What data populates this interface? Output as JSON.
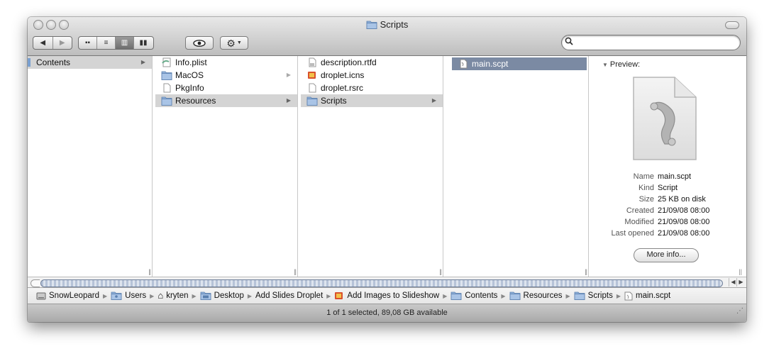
{
  "window": {
    "title": "Scripts"
  },
  "toolbar": {
    "view_buttons": [
      "icon-view-icon",
      "list-view-icon",
      "column-view-icon",
      "coverflow-view-icon"
    ],
    "active_view": "column"
  },
  "columns": [
    {
      "items": [
        {
          "label": "Contents",
          "icon": "folder-icon",
          "selected": true,
          "arrow": true
        }
      ]
    },
    {
      "items": [
        {
          "label": "Info.plist",
          "icon": "plist-file-icon"
        },
        {
          "label": "MacOS",
          "icon": "folder-icon",
          "arrow": true
        },
        {
          "label": "PkgInfo",
          "icon": "document-icon"
        },
        {
          "label": "Resources",
          "icon": "folder-icon",
          "selected": true,
          "arrow": true
        }
      ]
    },
    {
      "items": [
        {
          "label": "description.rtfd",
          "icon": "rtfd-file-icon"
        },
        {
          "label": "droplet.icns",
          "icon": "icns-file-icon"
        },
        {
          "label": "droplet.rsrc",
          "icon": "document-icon"
        },
        {
          "label": "Scripts",
          "icon": "folder-icon",
          "selected": true,
          "arrow": true
        }
      ]
    },
    {
      "items": [
        {
          "label": "main.scpt",
          "icon": "script-file-icon",
          "selected": true
        }
      ]
    }
  ],
  "preview": {
    "label": "Preview:",
    "fields": [
      {
        "key": "Name",
        "value": "main.scpt"
      },
      {
        "key": "Kind",
        "value": "Script"
      },
      {
        "key": "Size",
        "value": "25 KB on disk"
      },
      {
        "key": "Created",
        "value": "21/09/08 08:00"
      },
      {
        "key": "Modified",
        "value": "21/09/08 08:00"
      },
      {
        "key": "Last opened",
        "value": "21/09/08 08:00"
      }
    ],
    "more_info_label": "More info..."
  },
  "pathbar": [
    {
      "label": "SnowLeopard",
      "icon": "hard-drive-icon"
    },
    {
      "label": "Users",
      "icon": "users-folder-icon"
    },
    {
      "label": "kryten",
      "icon": "home-icon"
    },
    {
      "label": "Desktop",
      "icon": "desktop-folder-icon"
    },
    {
      "label": "Add Slides Droplet",
      "icon": "none"
    },
    {
      "label": "Add Images to Slideshow",
      "icon": "droplet-app-icon"
    },
    {
      "label": "Contents",
      "icon": "folder-icon"
    },
    {
      "label": "Resources",
      "icon": "folder-icon"
    },
    {
      "label": "Scripts",
      "icon": "folder-icon"
    },
    {
      "label": "main.scpt",
      "icon": "script-file-icon"
    }
  ],
  "status": {
    "text": "1 of 1 selected, 89,08 GB available"
  },
  "colors": {
    "selection_blue": "#7b8aa3",
    "selection_gray": "#d4d4d4",
    "folder_blue": "#8fb0d9"
  }
}
